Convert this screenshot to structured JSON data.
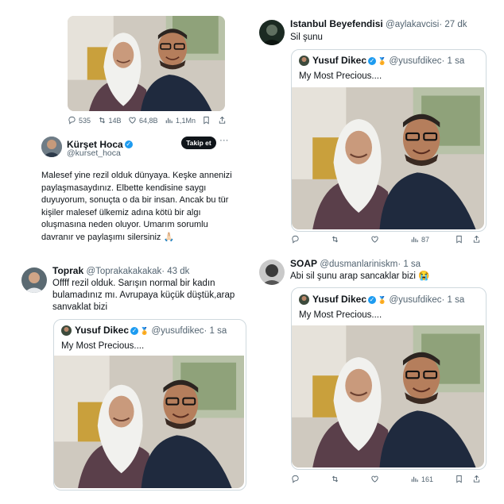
{
  "tweet_top_left": {
    "stats": {
      "replies": "535",
      "retweets": "14B",
      "likes": "64,8B",
      "views": "1,1Mn"
    },
    "author": {
      "name": "Kürşet Hoca",
      "handle": "@kurset_hoca"
    },
    "follow_label": "Takip et",
    "more_label": "···",
    "text": "Malesef yine rezil olduk dünyaya. Keşke annenizi paylaşmasaydınız. Elbette kendisine saygı duyuyorum, sonuçta o da bir insan. Ancak bu tür kişiler malesef ülkemiz adına kötü bir algı oluşmasına neden oluyor. Umarım sorumlu davranır ve paylaşımı silersiniz 🙏🏻"
  },
  "tweet_top_right": {
    "author": {
      "name": "Istanbul Beyefendisi",
      "handle": "@aylakavcisi",
      "time": "· 27 dk"
    },
    "text": "Sil şunu",
    "quote": {
      "name": "Yusuf Dikec",
      "handle": "@yusufdikec",
      "time": "· 1 sa",
      "text": "My Most Precious...."
    },
    "stats": {
      "views": "87"
    }
  },
  "tweet_bottom_left": {
    "author": {
      "name": "Toprak",
      "handle": "@Toprakakakakak",
      "time": "· 43 dk"
    },
    "text": "Offff rezil olduk. Sarışın normal bir kadın bulamadınız mı. Avrupaya küçük düştük,arap sanvaklat bizi",
    "quote": {
      "name": "Yusuf Dikec",
      "handle": "@yusufdikec",
      "time": "· 1 sa",
      "text": "My Most Precious...."
    }
  },
  "tweet_bottom_right": {
    "author": {
      "name": "SOAP",
      "handle": "@dusmanlariniskm",
      "time": "· 1 sa"
    },
    "text": "Abi sil şunu arap sancaklar bizi 😭",
    "quote": {
      "name": "Yusuf Dikec",
      "handle": "@yusufdikec",
      "time": "· 1 sa",
      "text": "My Most Precious...."
    },
    "stats": {
      "views": "161"
    }
  },
  "icons": {
    "verified": "verified-badge-icon",
    "flag": "medal-icon",
    "reply": "reply-icon",
    "retweet": "retweet-icon",
    "like": "heart-icon",
    "views": "bar-chart-icon",
    "bookmark": "bookmark-icon",
    "share": "share-icon"
  },
  "colors": {
    "accent": "#1d9bf0",
    "text": "#0f1419",
    "muted": "#536471",
    "border": "#cfd9de"
  }
}
